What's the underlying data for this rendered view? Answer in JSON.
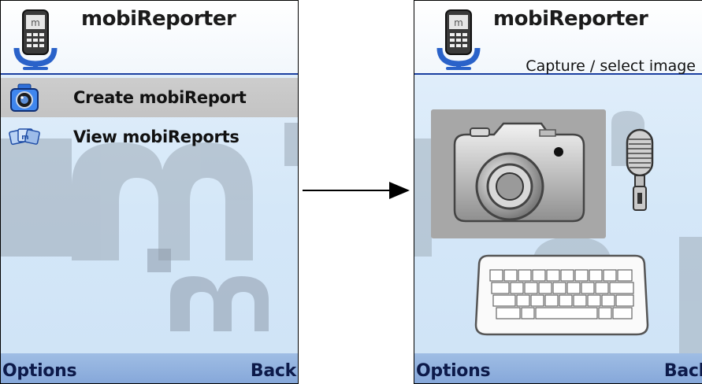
{
  "left_screen": {
    "app_title": "mobiReporter",
    "menu_items": [
      {
        "label": "Create mobiReport",
        "icon": "camera-icon",
        "selected": true
      },
      {
        "label": "View mobiReports",
        "icon": "reports-stack-icon",
        "selected": false
      }
    ],
    "softkeys": {
      "left": "Options",
      "right": "Back"
    }
  },
  "right_screen": {
    "app_title": "mobiReporter",
    "subtitle": "Capture / select image",
    "tiles": [
      {
        "icon": "photo-camera-icon",
        "selected": true
      },
      {
        "icon": "microphone-icon",
        "selected": false
      },
      {
        "icon": "keyboard-icon",
        "selected": false
      }
    ],
    "softkeys": {
      "left": "Options",
      "right": "Back"
    }
  },
  "colors": {
    "header_rule": "#1a3fa0",
    "softkey_bar": "#9fbde4",
    "selection": "#c6c6c6",
    "background": "#d4e7f8"
  }
}
